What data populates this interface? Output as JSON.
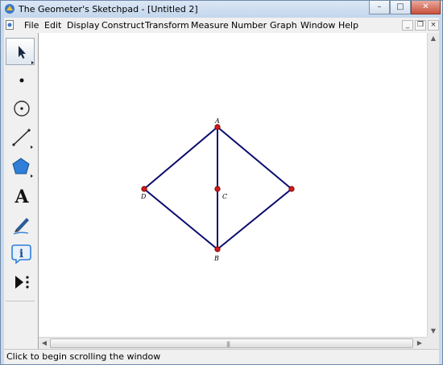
{
  "window": {
    "title": "The Geometer's Sketchpad - [Untitled 2]",
    "controls": {
      "minimize": "–",
      "maximize": "□",
      "close": "✕"
    }
  },
  "menubar": {
    "items": [
      "File",
      "Edit",
      "Display",
      "Construct",
      "Transform",
      "Measure",
      "Number",
      "Graph",
      "Window",
      "Help"
    ],
    "doc_controls": {
      "minimize": "_",
      "restore": "❐",
      "close": "×"
    }
  },
  "toolbox": {
    "tools": [
      {
        "name": "selection-arrow-tool",
        "icon": "arrow-icon",
        "selected": true
      },
      {
        "name": "point-tool",
        "icon": "point-icon"
      },
      {
        "name": "compass-tool",
        "icon": "circle-icon"
      },
      {
        "name": "straightedge-tool",
        "icon": "line-segment-icon"
      },
      {
        "name": "polygon-tool",
        "icon": "pentagon-icon"
      },
      {
        "name": "text-tool",
        "icon": "text-A-icon",
        "label": "A"
      },
      {
        "name": "marker-tool",
        "icon": "pen-icon"
      },
      {
        "name": "information-tool",
        "icon": "info-icon",
        "label": "i"
      },
      {
        "name": "custom-tool",
        "icon": "play-dots-icon"
      }
    ]
  },
  "sketch": {
    "points": [
      {
        "label": "A"
      },
      {
        "label": "B"
      },
      {
        "label": "C"
      },
      {
        "label": "D"
      },
      {
        "label": ""
      }
    ],
    "segment_color": "#0b0b6e",
    "point_color": "#d11a1a"
  },
  "colors": {
    "titlebar": "#c9daee",
    "accent": "#0b0b6e",
    "point": "#d11a1a"
  },
  "statusbar": {
    "text": "Click to begin scrolling the window"
  }
}
